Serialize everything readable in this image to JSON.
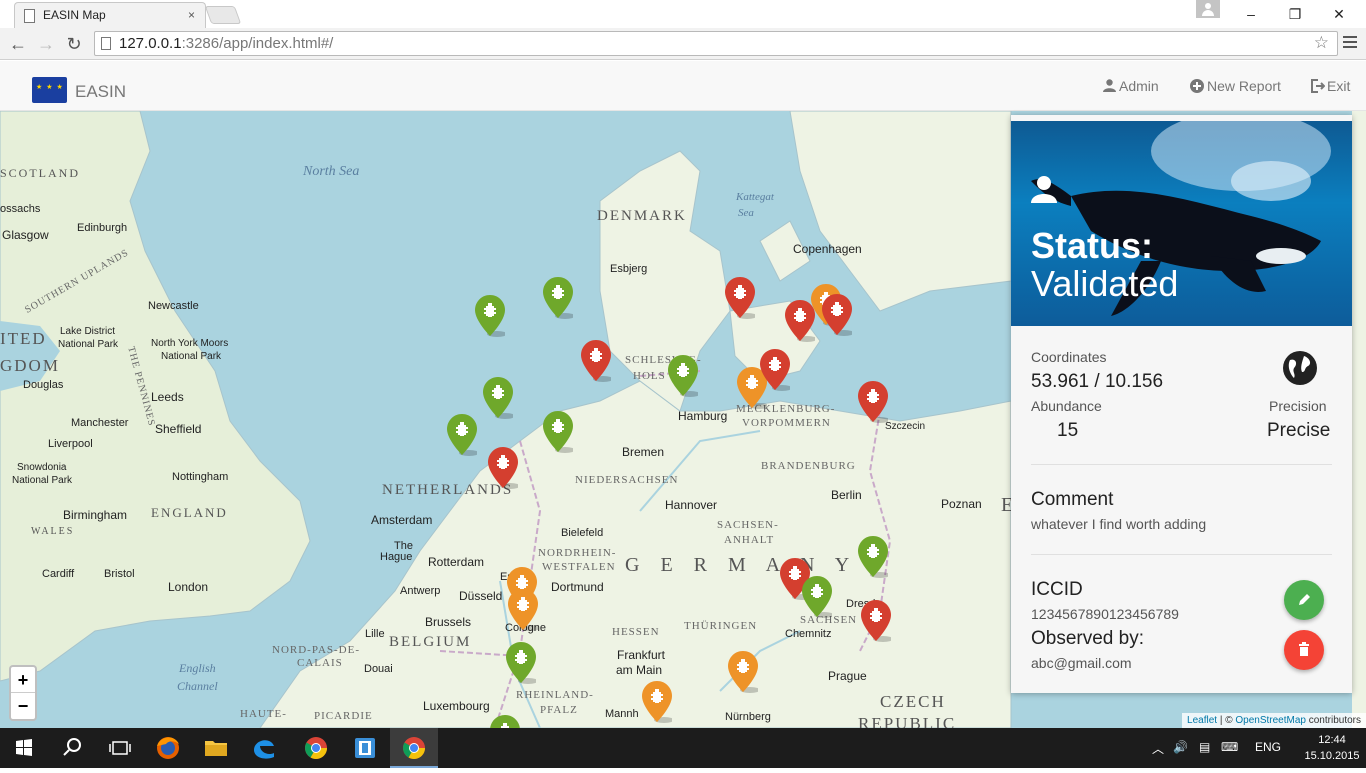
{
  "browser": {
    "tab_title": "EASIN Map",
    "tab_close": "×",
    "url_host": "127.0.0.1",
    "url_rest": ":3286/app/index.html#/",
    "window_controls": [
      "–",
      "❐",
      "✕"
    ]
  },
  "app": {
    "brand": "EASIN",
    "nav": [
      {
        "label": "Admin",
        "icon": "user-icon"
      },
      {
        "label": "New Report",
        "icon": "plus-circle-icon"
      },
      {
        "label": "Exit",
        "icon": "logout-icon"
      }
    ]
  },
  "map": {
    "labels": {
      "north_sea": "North Sea",
      "kattegat": "Kattegat",
      "kattegat_sea": "Sea",
      "denmark": "DENMARK",
      "netherlands": "NETHERLANDS",
      "germany": "G E R M A N Y",
      "belgium": "BELGIUM",
      "england": "ENGLAND",
      "czech": "CZECH",
      "republic": "REPUBLIC",
      "scotland": "SCOTLAND",
      "wales": "WALES",
      "southern_uplands": "SOUTHERN UPLANDS",
      "pennines": "THE PENNINES",
      "ited": "ITED",
      "gdom": "GDOM",
      "schleswig": "SCHLESWIG-",
      "holstein": "HOLS",
      "mecklenburg": "MECKLENBURG-",
      "vorpommern": "VORPOMMERN",
      "niedersachsen": "NIEDERSACHSEN",
      "brandenburg": "BRANDENBURG",
      "sachsen_anhalt": "SACHSEN-",
      "anhalt": "ANHALT",
      "nrw1": "NORDRHEIN-",
      "nrw2": "WESTFALEN",
      "hessen": "HESSEN",
      "thueringen": "THÜRINGEN",
      "sachsen": "SACHSEN",
      "rheinland": "RHEINLAND-",
      "pfalz": "PFALZ",
      "nord_pas": "NORD-PAS-DE-",
      "calais": "CALAIS",
      "picardie": "PICARDIE",
      "haute": "HAUTE-",
      "english_channel1": "English",
      "english_channel2": "Channel",
      "copenhagen": "Copenhagen",
      "esbjerg": "Esbjerg",
      "hamburg": "Hamburg",
      "bremen": "Bremen",
      "hannover": "Hannover",
      "berlin": "Berlin",
      "szczecin": "Szczecin",
      "poznan": "Poznan",
      "amsterdam": "Amsterdam",
      "the": "The",
      "hague": "Hague",
      "rotterdam": "Rotterdam",
      "bielefeld": "Bielefeld",
      "essen": "Essen",
      "dortmund": "Dortmund",
      "dusseldorf": "Düsseld",
      "cologne": "Cologne",
      "antwerp": "Antwerp",
      "brussels": "Brussels",
      "lille": "Lille",
      "douai": "Douai",
      "luxembourg": "Luxembourg",
      "frankfurt1": "Frankfurt",
      "frankfurt2": "am Main",
      "nurnberg": "Nürnberg",
      "chemnitz": "Chemnitz",
      "dresden": "Dresd",
      "prague": "Prague",
      "leeds": "Leeds",
      "sheffield": "Sheffield",
      "manchester": "Manchester",
      "liverpool": "Liverpool",
      "nottingham": "Nottingham",
      "birmingham": "Birmingham",
      "london": "London",
      "cardiff": "Cardiff",
      "bristol": "Bristol",
      "newcastle": "Newcastle",
      "edinburgh": "Edinburgh",
      "glasgow": "Glasgow",
      "douglas": "Douglas",
      "lake1": "Lake District",
      "lake2": "National Park",
      "nym1": "North York Moors",
      "nym2": "National Park",
      "snow1": "Snowdonia",
      "snow2": "National Park",
      "ossachs": "ossachs",
      "e_hint": "E",
      "mannh": "Mannh"
    },
    "markers": [
      {
        "status": "validated",
        "color": "#6fa82b"
      },
      {
        "status": "validated",
        "color": "#6fa82b"
      },
      {
        "status": "rejected",
        "color": "#d43f2f"
      },
      {
        "status": "validated",
        "color": "#6fa82b"
      },
      {
        "status": "validated",
        "color": "#6fa82b"
      },
      {
        "status": "validated",
        "color": "#6fa82b"
      },
      {
        "status": "rejected",
        "color": "#d43f2f"
      },
      {
        "status": "validated",
        "color": "#6fa82b"
      },
      {
        "status": "pending",
        "color": "#ee9328"
      },
      {
        "status": "rejected",
        "color": "#d43f2f"
      },
      {
        "status": "rejected",
        "color": "#d43f2f"
      },
      {
        "status": "rejected",
        "color": "#d43f2f"
      },
      {
        "status": "pending",
        "color": "#ee9328"
      },
      {
        "status": "rejected",
        "color": "#d43f2f"
      },
      {
        "status": "rejected",
        "color": "#d43f2f"
      },
      {
        "status": "validated",
        "color": "#6fa82b"
      },
      {
        "status": "rejected",
        "color": "#d43f2f"
      },
      {
        "status": "validated",
        "color": "#6fa82b"
      },
      {
        "status": "rejected",
        "color": "#d43f2f"
      },
      {
        "status": "pending",
        "color": "#ee9328"
      },
      {
        "status": "pending",
        "color": "#ee9328"
      },
      {
        "status": "validated",
        "color": "#6fa82b"
      },
      {
        "status": "pending",
        "color": "#ee9328"
      },
      {
        "status": "pending",
        "color": "#ee9328"
      },
      {
        "status": "validated",
        "color": "#6fa82b"
      }
    ],
    "zoom_in": "+",
    "zoom_out": "−",
    "attribution": {
      "leaflet": "Leaflet",
      "sep": " | © ",
      "osm": "OpenStreetMap",
      "contributors": " contributors"
    }
  },
  "panel": {
    "status_label": "Status:",
    "status_value": "Validated",
    "coordinates_label": "Coordinates",
    "coordinates_value": "53.961 / 10.156",
    "abundance_label": "Abundance",
    "abundance_value": "15",
    "precision_label": "Precision",
    "precision_value": "Precise",
    "comment_label": "Comment",
    "comment_value": "whatever I find worth adding",
    "iccid_label": "ICCID",
    "iccid_value": "1234567890123456789",
    "observed_label": "Observed by:",
    "observed_value": "abc@gmail.com",
    "edit_color": "#4caf50",
    "delete_color": "#f44336"
  },
  "taskbar": {
    "language": "ENG",
    "time": "12:44",
    "date": "15.10.2015"
  }
}
